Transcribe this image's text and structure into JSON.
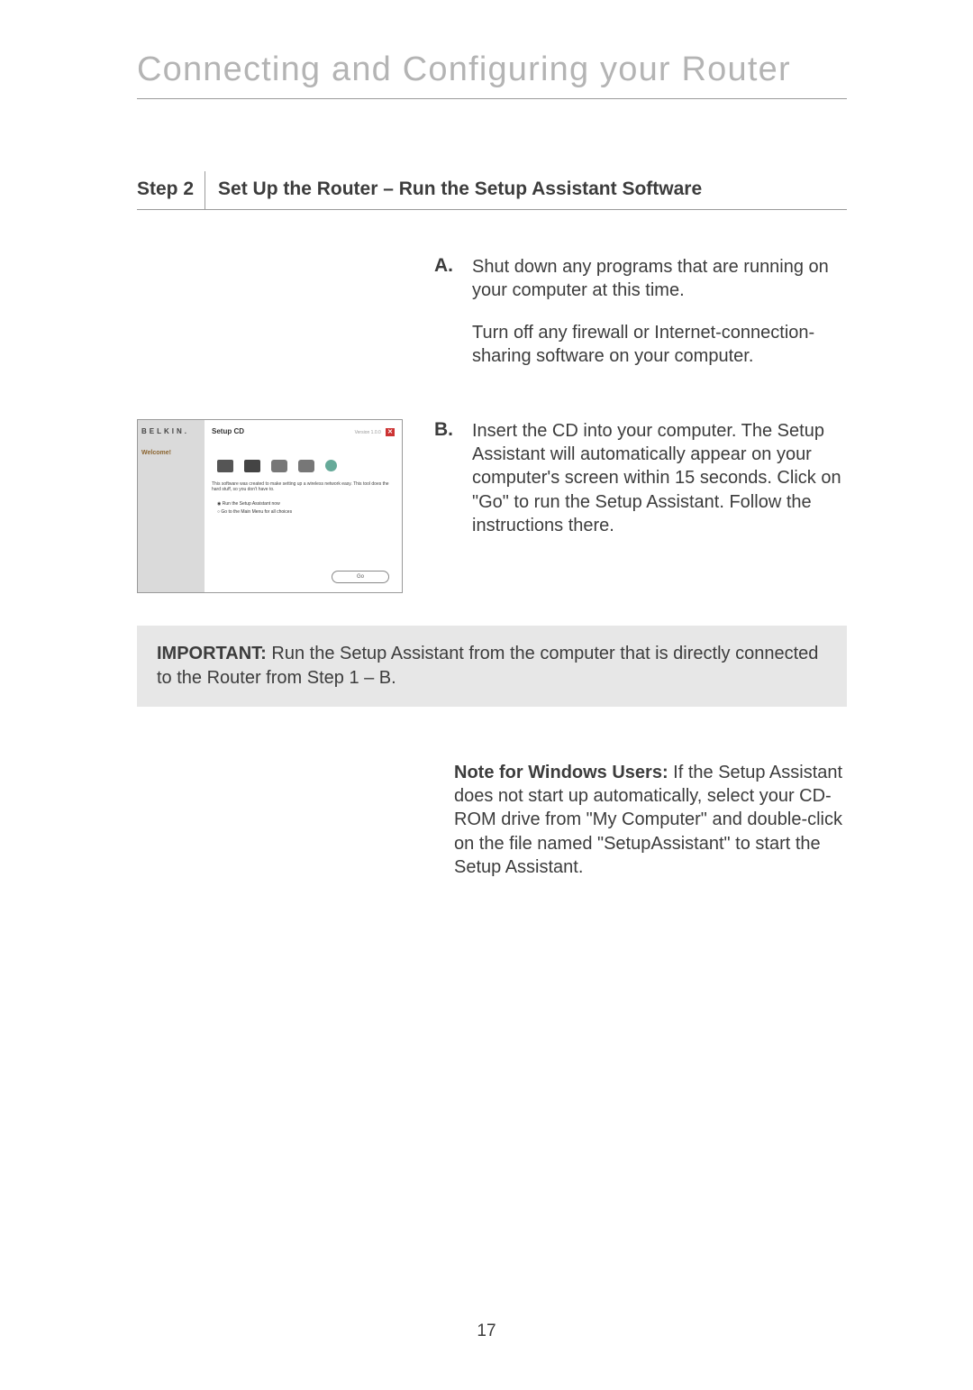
{
  "page": {
    "title": "Connecting and Configuring your Router",
    "number": "17"
  },
  "step": {
    "label": "Step 2",
    "title": "Set Up the Router – Run the Setup Assistant Software"
  },
  "items": {
    "a": {
      "letter": "A.",
      "p1": "Shut down any programs that are running on your computer at this time.",
      "p2": "Turn off any firewall or Internet-connection-sharing software on your computer."
    },
    "b": {
      "letter": "B.",
      "p1": "Insert the CD into your computer. The Setup Assistant will automatically appear on your computer's screen within 15 seconds. Click on \"Go\" to run the Setup Assistant. Follow the instructions there."
    }
  },
  "screenshot": {
    "brand": "BELKIN.",
    "sidebar_label": "Welcome!",
    "title": "Setup CD",
    "version": "Version 1.0.0",
    "close": "✕",
    "desc": "This software was created to make setting up a wireless network easy. This tool does the hard stuff, so you don't have to.",
    "radio1": "Run the Setup Assistant now",
    "radio2": "Go to the Main Menu for all choices",
    "go_button": "Go"
  },
  "important": {
    "label": "IMPORTANT:",
    "text": " Run the Setup Assistant from the computer that is directly connected to the Router from Step 1 – B."
  },
  "note": {
    "label": "Note for Windows Users:",
    "text": " If the Setup Assistant does not start up automatically, select your CD-ROM drive from \"My Computer\" and double-click on the file named \"SetupAssistant\" to start the Setup Assistant."
  }
}
